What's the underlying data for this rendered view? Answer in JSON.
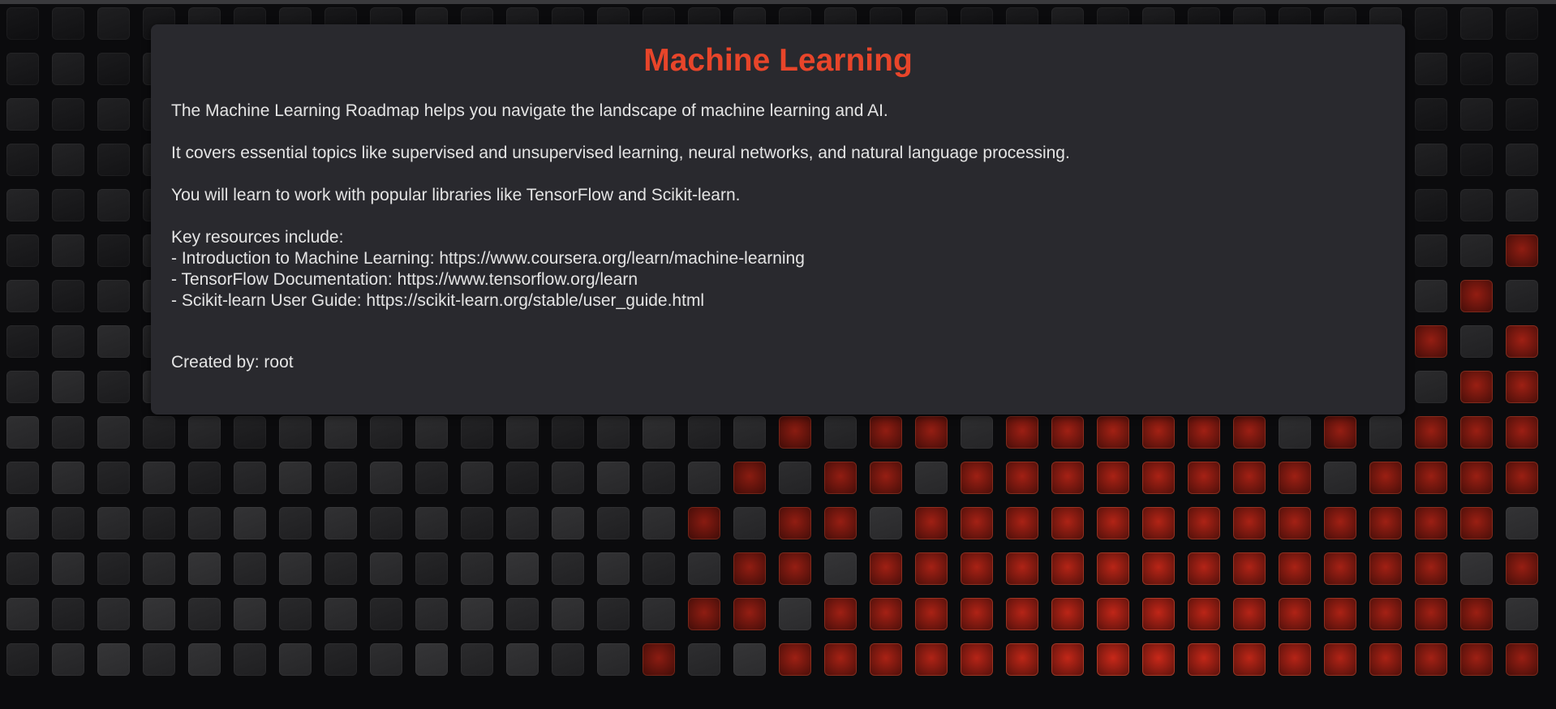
{
  "card": {
    "title": "Machine Learning",
    "paragraphs": [
      "The Machine Learning Roadmap helps you navigate the landscape of machine learning and AI.",
      "It covers essential topics like supervised and unsupervised learning, neural networks, and natural language processing.",
      "You will learn to work with popular libraries like TensorFlow and Scikit-learn."
    ],
    "resources_heading": "Key resources include:",
    "resources": [
      "- Introduction to Machine Learning: https://www.coursera.org/learn/machine-learning",
      "- TensorFlow Documentation: https://www.tensorflow.org/learn",
      "- Scikit-learn User Guide: https://scikit-learn.org/stable/user_guide.html"
    ],
    "footer": "Created by: root"
  },
  "colors": {
    "title": "#e8452a",
    "card_background": "#29292e",
    "page_background": "#0b0b0d",
    "tile_red": "#8a1a12",
    "tile_grey": "#2a2a2d"
  }
}
